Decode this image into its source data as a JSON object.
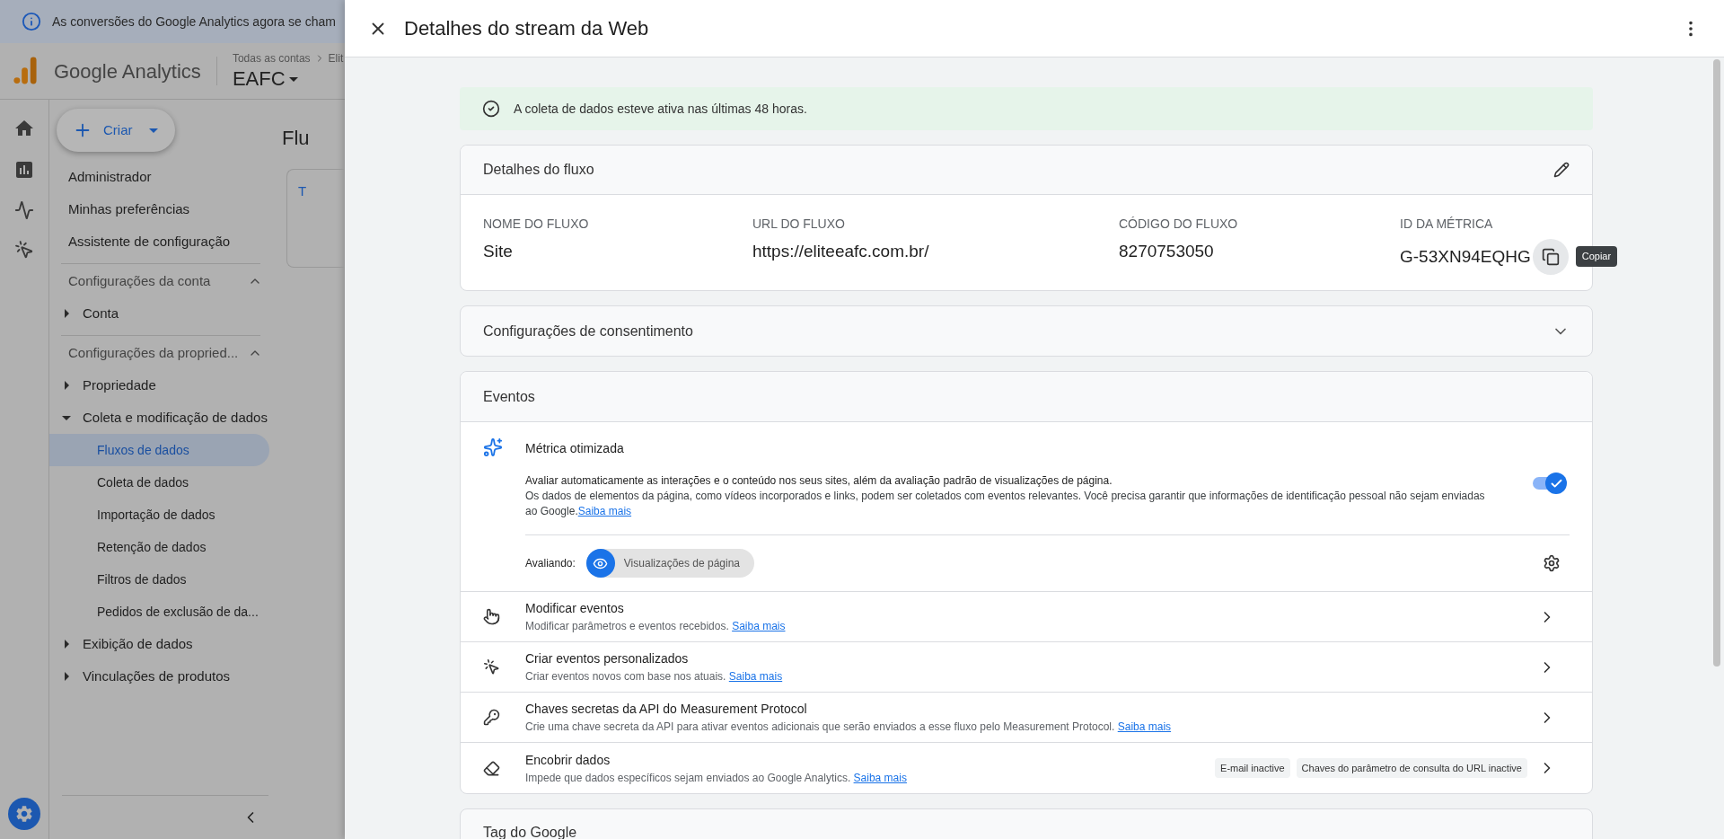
{
  "banner": {
    "text": "As conversões do Google Analytics agora se cham"
  },
  "header": {
    "product": "Google Analytics",
    "breadcrumb": "Todas as contas",
    "breadcrumb_next": "Elit",
    "property": "EAFC"
  },
  "create_button": {
    "label": "Criar"
  },
  "nav": {
    "top_items": [
      "Administrador",
      "Minhas preferências",
      "Assistente de configuração"
    ],
    "sections": [
      {
        "title": "Configurações da conta",
        "expanded": true,
        "items": [
          {
            "label": "Conta",
            "expanded": false
          }
        ]
      },
      {
        "title": "Configurações da propried...",
        "expanded": true,
        "items": [
          {
            "label": "Propriedade",
            "expanded": false
          },
          {
            "label": "Coleta e modificação de dados",
            "expanded": true,
            "children": [
              {
                "label": "Fluxos de dados",
                "selected": true
              },
              {
                "label": "Coleta de dados",
                "selected": false
              },
              {
                "label": "Importação de dados",
                "selected": false
              },
              {
                "label": "Retenção de dados",
                "selected": false
              },
              {
                "label": "Filtros de dados",
                "selected": false
              },
              {
                "label": "Pedidos de exclusão de da...",
                "selected": false
              }
            ]
          },
          {
            "label": "Exibição de dados",
            "expanded": false
          },
          {
            "label": "Vinculações de produtos",
            "expanded": false
          }
        ]
      }
    ]
  },
  "background_page": {
    "title": "Flu",
    "tab": "T"
  },
  "panel": {
    "title": "Detalhes do stream da Web",
    "status": "A coleta de dados esteve ativa nas últimas 48 horas.",
    "stream_details": {
      "title": "Detalhes do fluxo",
      "fields": [
        {
          "label": "NOME DO FLUXO",
          "value": "Site"
        },
        {
          "label": "URL DO FLUXO",
          "value": "https://eliteeafc.com.br/"
        },
        {
          "label": "CÓDIGO DO FLUXO",
          "value": "8270753050"
        },
        {
          "label": "ID DA MÉTRICA",
          "value": "G-53XN94EQHG"
        }
      ],
      "copy_tooltip": "Copiar"
    },
    "consent": {
      "title": "Configurações de consentimento",
      "expanded": false
    },
    "events": {
      "title": "Eventos",
      "enhanced": {
        "title": "Métrica otimizada",
        "description": "Avaliar automaticamente as interações e o conteúdo nos seus sites, além da avaliação padrão de visualizações de página.",
        "detail": "Os dados de elementos da página, como vídeos incorporados e links, podem ser coletados com eventos relevantes. Você precisa garantir que informações de identificação pessoal não sejam enviadas ao Google.",
        "link": "Saiba mais",
        "on": true,
        "measuring_label": "Avaliando:",
        "measuring_chip": "Visualizações de página"
      },
      "rows": [
        {
          "kind": "touch",
          "title": "Modificar eventos",
          "description": "Modificar parâmetros e eventos recebidos.",
          "link": "Saiba mais"
        },
        {
          "kind": "click",
          "title": "Criar eventos personalizados",
          "description": "Criar eventos novos com base nos atuais.",
          "link": "Saiba mais"
        },
        {
          "kind": "key",
          "title": "Chaves secretas da API do Measurement Protocol",
          "description": "Crie uma chave secreta da API para ativar eventos adicionais que serão enviados a esse fluxo pelo Measurement Protocol.",
          "link": "Saiba mais"
        },
        {
          "kind": "eraser",
          "title": "Encobrir dados",
          "description": "Impede que dados específicos sejam enviados ao Google Analytics.",
          "link": "Saiba mais",
          "chips": [
            "E-mail inactive",
            "Chaves do parâmetro de consulta do URL inactive"
          ]
        }
      ]
    },
    "google_tag": {
      "title": "Tag do Google"
    }
  }
}
